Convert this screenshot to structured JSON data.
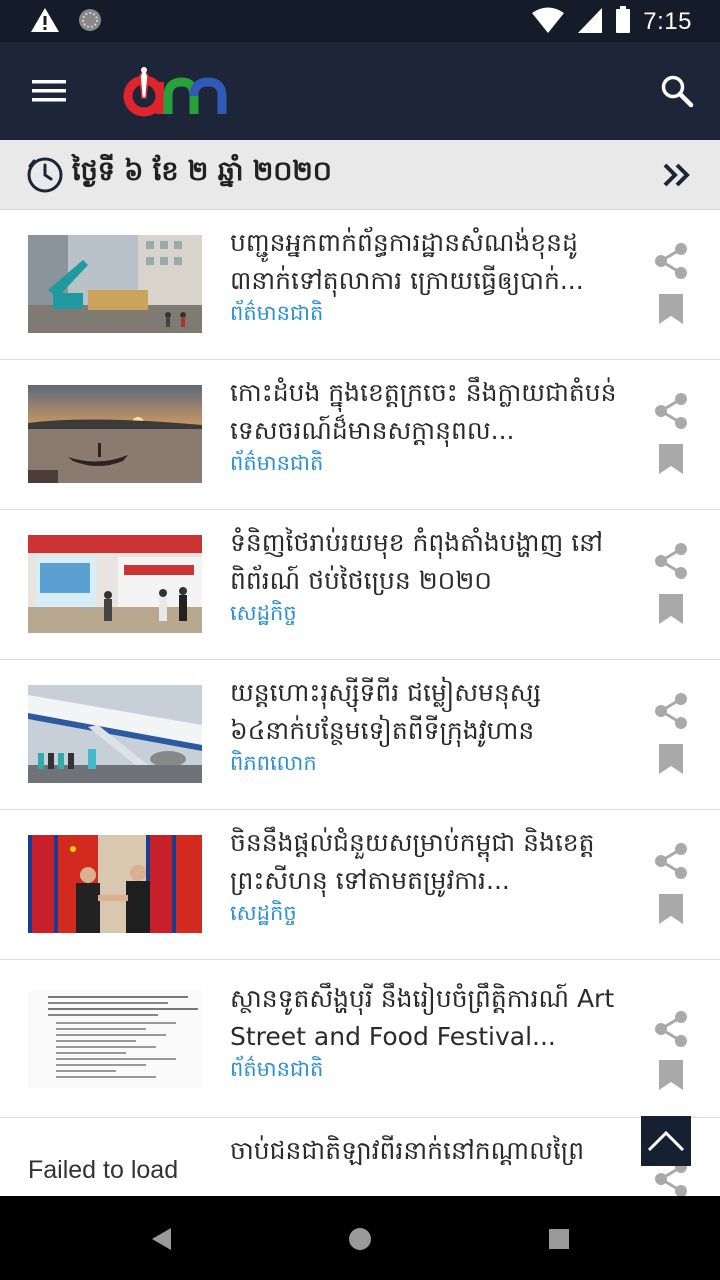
{
  "status_bar": {
    "time": "7:15"
  },
  "app_bar": {
    "logo_text": "am"
  },
  "date_bar": {
    "date": "ថ្ងៃទី ៦ ខែ ២ ឆ្នាំ ២០២០"
  },
  "articles": [
    {
      "title": "បញ្ជូនអ្នកពាក់ព័ន្ធការដ្ឋានសំណង់ខុនដូ ៣នាក់ទៅតុលាការ ក្រោយធ្វើឲ្យបាក់...",
      "category": "ព័ត៌មានជាតិ",
      "thumb": "construction-site"
    },
    {
      "title": "កោះដំបង ក្នុងខេត្តក្រចេះ នឹងក្លាយជាតំបន់ទេសចរណ៍ដ៏មានសក្តានុពល...",
      "category": "ព័ត៌មានជាតិ",
      "thumb": "river-sunset"
    },
    {
      "title": "ទំនិញថៃរាប់រយមុខ កំពុងតាំងបង្ហាញ នៅពិព័រណ៍ ថប់ថៃប្រេន ២០២០",
      "category": "សេដ្ឋកិច្ច",
      "thumb": "trade-fair"
    },
    {
      "title": "យន្តហោះរុស្ស៊ីទីពីរ ជម្លៀសមនុស្ស ៦៤នាក់បន្ថែមទៀតពីទីក្រុងវូហាន",
      "category": "ពិភពលោក",
      "thumb": "airplane"
    },
    {
      "title": "ចិននឹងផ្តល់ជំនួយសម្រាប់កម្ពុជា និងខេត្តព្រះសីហនុ ទៅតាមតម្រូវការ...",
      "category": "សេដ្ឋកិច្ច",
      "thumb": "handshake-flags"
    },
    {
      "title": "ស្ថានទូតសឹង្ហបុរី នឹងរៀបចំព្រឹត្តិការណ៍ Art Street and Food Festival...",
      "category": "ព័ត៌មានជាតិ",
      "thumb": "document-page"
    },
    {
      "title": "ចាប់ជនជាតិឡាវពីរនាក់នៅកណ្តាលព្រៃ",
      "category": "",
      "thumb": "failed",
      "thumb_text": "Failed to load"
    }
  ],
  "colors": {
    "app_bar": "#1c2638",
    "status_bar": "#141c2a",
    "category": "#2b8fd0",
    "icon_gray": "#a9a9a9"
  }
}
